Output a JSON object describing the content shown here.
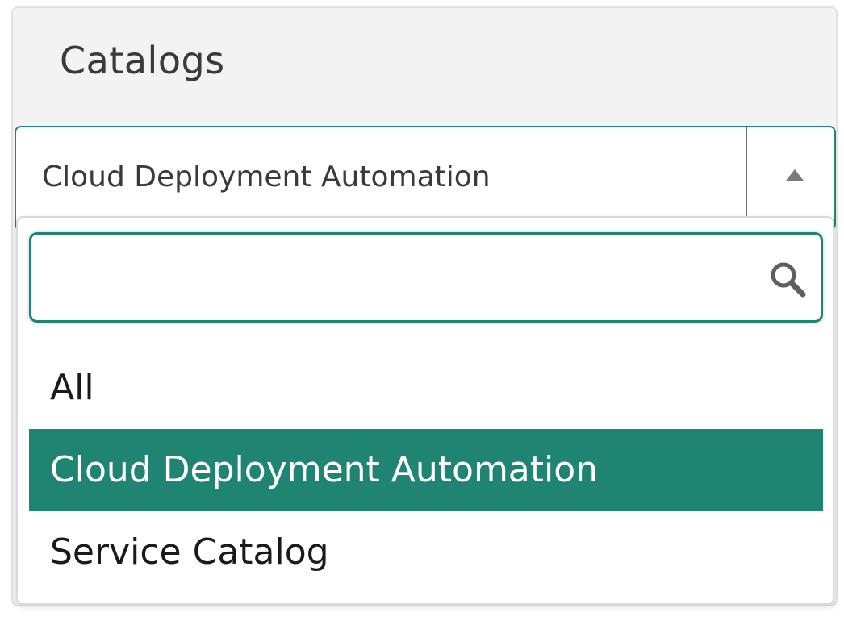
{
  "panel": {
    "title": "Catalogs"
  },
  "select": {
    "value": "Cloud Deployment Automation",
    "toggle_icon": "caret-up-icon",
    "expanded": true
  },
  "dropdown": {
    "search": {
      "value": "",
      "placeholder": "",
      "icon": "search-icon"
    },
    "options": [
      {
        "label": "All",
        "selected": false
      },
      {
        "label": "Cloud Deployment Automation",
        "selected": true
      },
      {
        "label": "Service Catalog",
        "selected": false
      }
    ]
  },
  "colors": {
    "accent": "#1f8471",
    "panel_bg": "#f3f3f3",
    "text": "#3a3a3a"
  }
}
